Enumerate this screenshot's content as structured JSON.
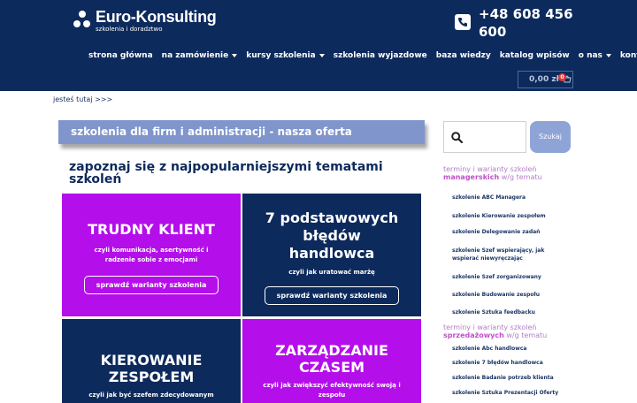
{
  "header": {
    "logo_title": "Euro-Konsulting",
    "logo_sub": "szkolenia i doradztwo",
    "phone": "+48 608 456 600",
    "nav": [
      {
        "label": "strona główna",
        "dropdown": false
      },
      {
        "label": "na zamówienie",
        "dropdown": true
      },
      {
        "label": "kursy szkolenia",
        "dropdown": true
      },
      {
        "label": "szkolenia wyjazdowe",
        "dropdown": false
      },
      {
        "label": "baza wiedzy",
        "dropdown": false
      },
      {
        "label": "katalog wpisów",
        "dropdown": false
      },
      {
        "label": "o nas",
        "dropdown": true
      },
      {
        "label": "kontakt",
        "dropdown": false
      }
    ],
    "cart_total": "0,00 zł",
    "cart_count": "0"
  },
  "breadcrumb": "jesteś tutaj >>>",
  "main": {
    "banner": "szkolenia dla firm i administracji - nasza oferta",
    "subheading": "zapoznaj się z najpopularniejszymi tematami szkoleń",
    "tiles": [
      {
        "title": "TRUDNY KLIENT",
        "sub": "czyli komunikacja, asertywność i radzenie sobie z emocjami",
        "button": "sprawdź warianty szkolenia",
        "color": "#b40eea"
      },
      {
        "title": "7 podstawowych błędów handlowca",
        "sub": "czyli jak uratować marżę",
        "button": "sprawdź warianty szkolenia",
        "color": "#0d2a5c"
      },
      {
        "title": "KIEROWANIE ZESPOŁEM",
        "sub": "czyli jak być szefem zdecydowanym",
        "button": "",
        "color": "#0d2a5c"
      },
      {
        "title": "ZARZĄDZANIE CZASEM",
        "sub": "czyli jak zwiększyć efektywność swoją i zespołu",
        "button": "",
        "color": "#b40eea"
      }
    ]
  },
  "sidebar": {
    "search_placeholder": "",
    "search_button": "Szukaj",
    "groups": [
      {
        "head_plain": "terminy i warianty szkoleń",
        "head_bold": "managerskich",
        "head_tail": "w/g tematu",
        "links": [
          "szkolenie ABC Managera",
          "szkolenie Kierowanie zespołem",
          "szkolenie Delegowanie zadań",
          "szkolenie Szef wspierający, jak wspierać niewyręczając",
          "szkolenie Szef zorganizowany",
          "szkolenie Budowanie zespołu",
          "szkolenie Sztuka feedbacku"
        ]
      },
      {
        "head_plain": "terminy i warianty szkoleń",
        "head_bold": "sprzedażowych",
        "head_tail": "w/g tematu",
        "links": [
          "szkolenie Abc handlowca",
          "szkolenie 7 błędów handlowca",
          "szkolenie Badanie potrzeb klienta",
          "szkolenie Sztuka Prezentacji Oferty"
        ]
      }
    ]
  }
}
